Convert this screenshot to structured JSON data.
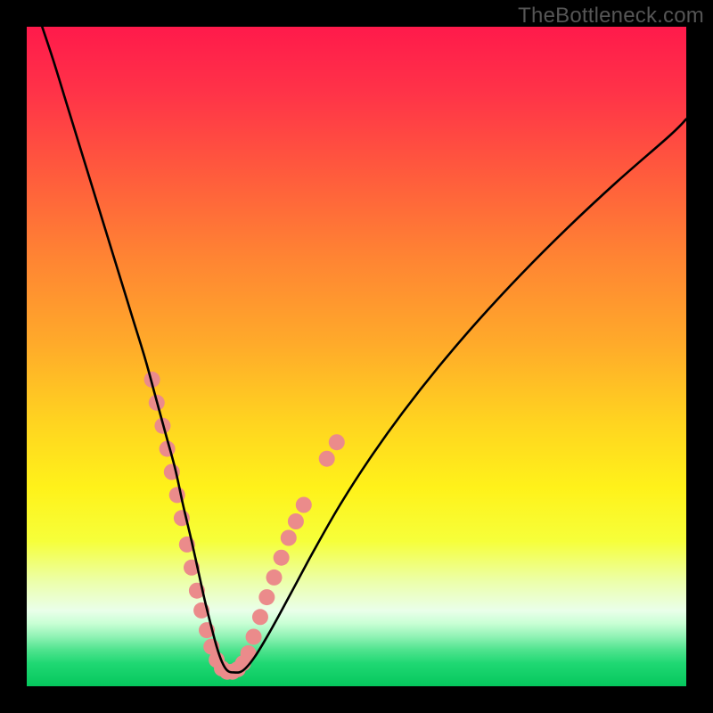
{
  "watermark": {
    "text": "TheBottleneck.com"
  },
  "chart_data": {
    "type": "line",
    "title": "",
    "xlabel": "",
    "ylabel": "",
    "xlim": [
      0,
      100
    ],
    "ylim": [
      0,
      100
    ],
    "grid": false,
    "legend": {
      "visible": false
    },
    "annotations": [
      "TheBottleneck.com"
    ],
    "background_gradient_stops": [
      {
        "pos": 0.0,
        "color": "#ff1a4b"
      },
      {
        "pos": 0.1,
        "color": "#ff3348"
      },
      {
        "pos": 0.22,
        "color": "#ff5a3d"
      },
      {
        "pos": 0.35,
        "color": "#ff8433"
      },
      {
        "pos": 0.48,
        "color": "#ffaa2a"
      },
      {
        "pos": 0.6,
        "color": "#ffd420"
      },
      {
        "pos": 0.7,
        "color": "#fff21a"
      },
      {
        "pos": 0.78,
        "color": "#f6ff3a"
      },
      {
        "pos": 0.84,
        "color": "#ecffa8"
      },
      {
        "pos": 0.885,
        "color": "#eaffea"
      },
      {
        "pos": 0.905,
        "color": "#c8ffd4"
      },
      {
        "pos": 0.925,
        "color": "#8ff2b4"
      },
      {
        "pos": 0.945,
        "color": "#4fe38e"
      },
      {
        "pos": 0.965,
        "color": "#20d873"
      },
      {
        "pos": 1.0,
        "color": "#05c75d"
      }
    ],
    "series": [
      {
        "name": "bottleneck-curve",
        "color": "#000000",
        "x": [
          2,
          4,
          6,
          8,
          10,
          12,
          14,
          16,
          18,
          19.5,
          21,
          22.5,
          23.7,
          25,
          26,
          27,
          28,
          28.8,
          29.6,
          30.4,
          31.4,
          32.8,
          34.6,
          37.0,
          40.0,
          43.5,
          47.5,
          52.0,
          57.0,
          62.5,
          68.5,
          75.0,
          82.0,
          89.5,
          97.5,
          100
        ],
        "y": [
          101,
          95,
          88.5,
          82,
          75.5,
          69,
          62.5,
          56,
          49.5,
          44,
          38.5,
          33,
          27.5,
          22,
          17.5,
          13,
          9,
          6,
          3.7,
          2.4,
          2.1,
          2.4,
          4.5,
          8.5,
          14,
          20.5,
          27.5,
          34.5,
          41.5,
          48.5,
          55.5,
          62.5,
          69.5,
          76.5,
          83.5,
          86
        ]
      }
    ],
    "marker_clusters": [
      {
        "name": "left-cluster",
        "color": "#eb8b8b",
        "radius": 9,
        "points": [
          {
            "x": 19.0,
            "y": 46.5
          },
          {
            "x": 19.7,
            "y": 43.0
          },
          {
            "x": 20.6,
            "y": 39.5
          },
          {
            "x": 21.3,
            "y": 36.0
          },
          {
            "x": 22.0,
            "y": 32.5
          },
          {
            "x": 22.8,
            "y": 29.0
          },
          {
            "x": 23.5,
            "y": 25.5
          },
          {
            "x": 24.3,
            "y": 21.5
          },
          {
            "x": 25.0,
            "y": 18.0
          },
          {
            "x": 25.8,
            "y": 14.5
          },
          {
            "x": 26.5,
            "y": 11.5
          },
          {
            "x": 27.3,
            "y": 8.5
          },
          {
            "x": 28.0,
            "y": 6.0
          },
          {
            "x": 28.8,
            "y": 4.0
          },
          {
            "x": 29.6,
            "y": 2.7
          },
          {
            "x": 30.4,
            "y": 2.2
          },
          {
            "x": 31.2,
            "y": 2.2
          },
          {
            "x": 32.0,
            "y": 2.6
          },
          {
            "x": 32.8,
            "y": 3.5
          }
        ]
      },
      {
        "name": "right-cluster",
        "color": "#eb8b8b",
        "radius": 9,
        "points": [
          {
            "x": 33.6,
            "y": 5.0
          },
          {
            "x": 34.4,
            "y": 7.5
          },
          {
            "x": 35.4,
            "y": 10.5
          },
          {
            "x": 36.4,
            "y": 13.5
          },
          {
            "x": 37.5,
            "y": 16.5
          },
          {
            "x": 38.6,
            "y": 19.5
          },
          {
            "x": 39.7,
            "y": 22.5
          },
          {
            "x": 40.8,
            "y": 25.0
          },
          {
            "x": 42.0,
            "y": 27.5
          },
          {
            "x": 45.5,
            "y": 34.5
          },
          {
            "x": 47.0,
            "y": 37.0
          }
        ]
      }
    ]
  }
}
